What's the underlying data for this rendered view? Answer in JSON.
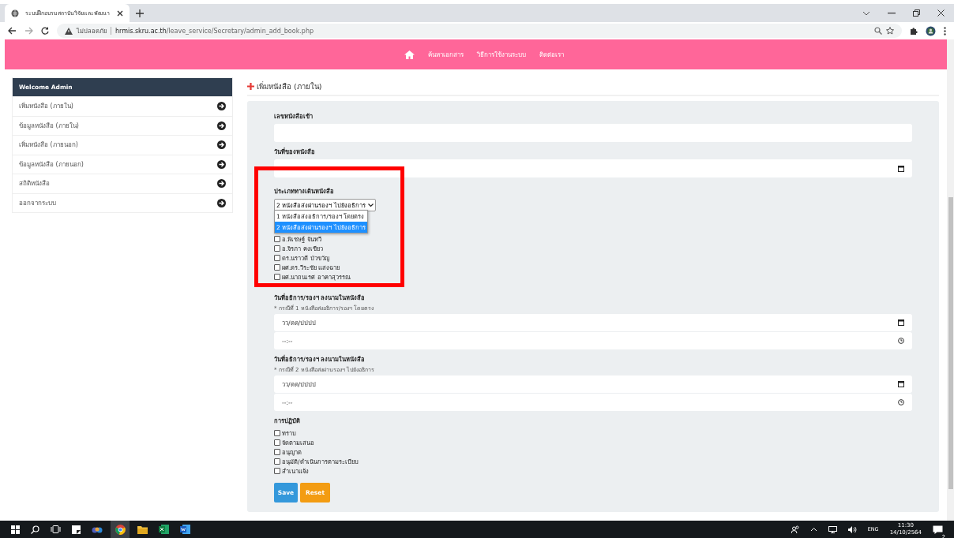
{
  "browser": {
    "tab_title": "ระบบฝึกอบรมสถาบันวิจัยและพัฒนา",
    "security": "ไม่ปลอดภัย",
    "url_host": "hrmis.skru.ac.th",
    "url_path": "/leave_service/Secretary/admin_add_book.php"
  },
  "nav": [
    "ค้นหาเอกสาร",
    "วิธีการใช้งานระบบ",
    "ติดต่อเรา"
  ],
  "sidebar": {
    "title": "Welcome Admin",
    "items": [
      {
        "label": "เพิ่มหนังสือ (ภายใน)"
      },
      {
        "label": "ข้อมูลหนังสือ (ภายใน)"
      },
      {
        "label": "เพิ่มหนังสือ (ภายนอก)"
      },
      {
        "label": "ข้อมูลหนังสือ (ภายนอก)"
      },
      {
        "label": "สถิติหนังสือ"
      },
      {
        "label": "ออกจากระบบ"
      }
    ]
  },
  "page_title": "เพิ่มหนังสือ (ภายใน)",
  "form": {
    "book_number_label": "เลขหนังสือเข้า",
    "book_date_label": "วันที่ของหนังสือ",
    "route_label": "ประเภททางเดินหนังสือ",
    "route_value": "2 หนังสือส่งผ่านรองฯ ไปยังอธิการ",
    "route_options": [
      {
        "label": "1 หนังสือส่งอธิการ/รองฯ โดยตรง",
        "selected": false
      },
      {
        "label": "2 หนังสือส่งผ่านรองฯ ไปยังอธิการ",
        "selected": true
      }
    ],
    "people": [
      {
        "label": "อ.พิเชษฐ์ จันทวี",
        "checked": false
      },
      {
        "label": "อ.จิรภา คงเขียว",
        "checked": false
      },
      {
        "label": "ดร.นราวดี บัวขวัญ",
        "checked": false
      },
      {
        "label": "ผศ.ดร.วีระชัย แสงฉาย",
        "checked": false
      },
      {
        "label": "ผศ.นาถนเรศ อาคาสุวรรณ",
        "checked": false
      }
    ],
    "sign_groups": [
      {
        "label": "วันที่อธิการ/รองฯ ลงนามในหนังสือ",
        "note": "* กรณีที่ 1 หนังสือส่งอธิการ/รองฯ โดยตรง",
        "date_placeholder": "วว/ดด/ปปปป",
        "time_placeholder": "--:--"
      },
      {
        "label": "วันที่อธิการ/รองฯ ลงนามในหนังสือ",
        "note": "* กรณีที่ 2 หนังสือส่งผ่านรองฯ ไปยังอธิการ",
        "date_placeholder": "วว/ดด/ปปปป",
        "time_placeholder": "--:--"
      }
    ],
    "action_label": "การปฏิบัติ",
    "actions": [
      {
        "label": "ทราบ",
        "checked": false
      },
      {
        "label": "จัดตามเสนอ",
        "checked": false
      },
      {
        "label": "อนุญาต",
        "checked": false
      },
      {
        "label": "อนุมัติ/ดำเนินการตามระเบียบ",
        "checked": false
      },
      {
        "label": "สำเนาแจ้ง",
        "checked": false
      }
    ],
    "buttons": [
      {
        "label": "Save",
        "kind": "primary"
      },
      {
        "label": "Reset",
        "kind": "warning"
      }
    ]
  },
  "taskbar": {
    "language": "ENG",
    "time": "11:30",
    "date": "14/10/2564",
    "notifications": "2"
  }
}
